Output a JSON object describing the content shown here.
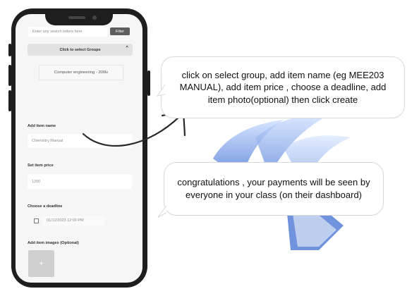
{
  "phone_ui": {
    "search_placeholder": "Enter any search letters here",
    "filter_label": "Filter",
    "groups_label": "Click to select Groups",
    "groups_chevron": "^",
    "group_option": "Computer engineering - 200lv",
    "item_name_label": "Add item name",
    "item_name_value": "Chemistry Manual",
    "item_price_label": "Set item price",
    "item_price_value": "1200",
    "deadline_label": "Choose a deadline",
    "deadline_value": "01/12/2023 12:00 PM",
    "images_label": "Add item images (Optional)",
    "add_image_symbol": "+"
  },
  "callouts": {
    "instruction": "click on select group, add item name (eg MEE203 MANUAL), add item price , choose a deadline, add item photo(optional) then click create",
    "confirmation": "congratulations , your payments will be seen by everyone in your class (on their dashboard)"
  },
  "colors": {
    "phone_frame": "#1e1e1e",
    "screen_bg": "#f6f6f6",
    "filter_button": "#5d5d5d",
    "logo_blue": "#4a78d6"
  }
}
